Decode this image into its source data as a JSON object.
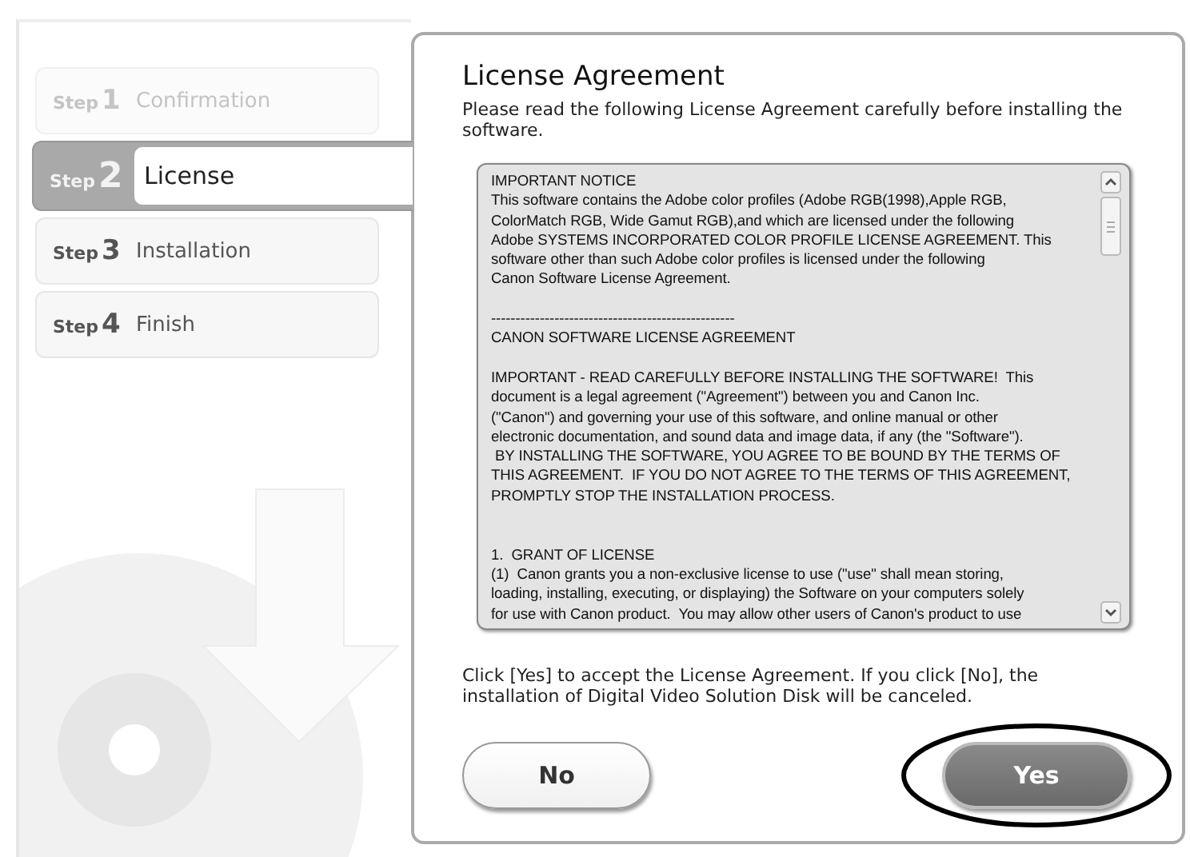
{
  "steps": [
    {
      "prefix": "Step",
      "number": "1",
      "label": "Confirmation",
      "done": true,
      "selected": false
    },
    {
      "prefix": "Step",
      "number": "2",
      "label": "License",
      "done": false,
      "selected": true
    },
    {
      "prefix": "Step",
      "number": "3",
      "label": "Installation",
      "done": false,
      "selected": false
    },
    {
      "prefix": "Step",
      "number": "4",
      "label": "Finish",
      "done": false,
      "selected": false
    }
  ],
  "panel": {
    "title": "License Agreement",
    "intro": "Please read the following License Agreement carefully before installing the software.",
    "license_text": "IMPORTANT NOTICE\nThis software contains the Adobe color profiles (Adobe RGB(1998),Apple RGB,\nColorMatch RGB, Wide Gamut RGB),and which are licensed under the following\nAdobe SYSTEMS INCORPORATED COLOR PROFILE LICENSE AGREEMENT. This\nsoftware other than such Adobe color profiles is licensed under the following\nCanon Software License Agreement.\n\n--------------------------------------------------\nCANON SOFTWARE LICENSE AGREEMENT\n\nIMPORTANT - READ CAREFULLY BEFORE INSTALLING THE SOFTWARE!  This\ndocument is a legal agreement (\"Agreement\") between you and Canon Inc.\n(\"Canon\") and governing your use of this software, and online manual or other\nelectronic documentation, and sound data and image data, if any (the \"Software\").\n BY INSTALLING THE SOFTWARE, YOU AGREE TO BE BOUND BY THE TERMS OF\nTHIS AGREEMENT.  IF YOU DO NOT AGREE TO THE TERMS OF THIS AGREEMENT,\nPROMPTLY STOP THE INSTALLATION PROCESS.\n\n\n1.  GRANT OF LICENSE\n(1)  Canon grants you a non-exclusive license to use (\"use\" shall mean storing,\nloading, installing, executing, or displaying) the Software on your computers solely\nfor use with Canon product.  You may allow other users of Canon's product to use",
    "note": "Click [Yes] to accept the License Agreement. If you click [No], the installation of Digital Video Solution Disk will be canceled.",
    "buttons": [
      {
        "label": "No",
        "kind": "secondary",
        "highlighted": false
      },
      {
        "label": "Yes",
        "kind": "primary",
        "highlighted": true
      }
    ]
  }
}
